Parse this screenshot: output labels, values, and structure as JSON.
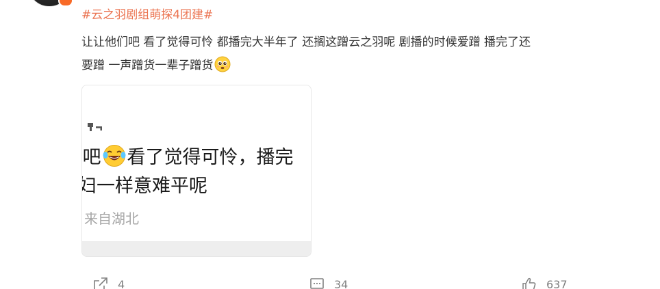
{
  "post": {
    "topic": "#云之羽剧组萌探4团建#",
    "text_line1": "让让他们吧 看了觉得可怜 都播完大半年了 还搁这蹭云之羽呢 剧播的时候爱蹭 播完了还",
    "text_line2": "要蹭 一声蹭货一辈子蹭货",
    "trailing_emoji": "pleading-face-emoji"
  },
  "image_card": {
    "line1_before": "]吧",
    "line1_emoji": "tears-of-joy-emoji",
    "line1_after": "看了觉得可怜，播完",
    "line2": "妇一样意难平呢",
    "location": "来自湖北",
    "icon": "comment-reply-icon"
  },
  "actions": {
    "repost_count": "4",
    "comment_count": "34",
    "like_count": "637"
  },
  "colors": {
    "topic": "#eb7350",
    "text": "#333333",
    "action": "#808080",
    "badge": "#f86a27"
  }
}
